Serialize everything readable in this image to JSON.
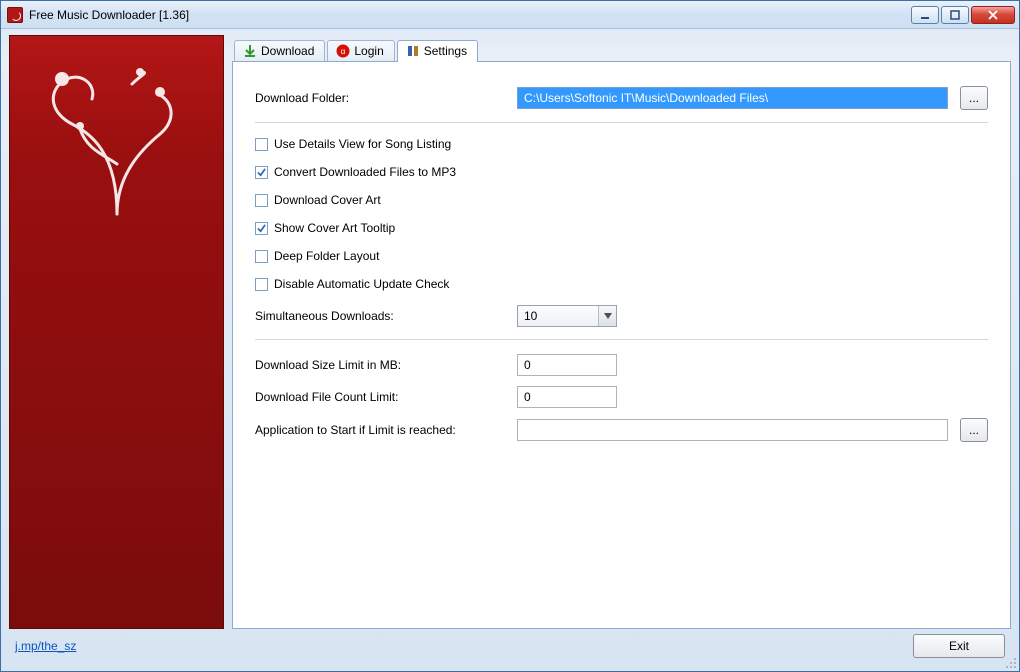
{
  "window": {
    "title": "Free Music Downloader [1.36]"
  },
  "tabs": {
    "download": "Download",
    "login": "Login",
    "settings": "Settings"
  },
  "settings": {
    "download_folder_label": "Download Folder:",
    "download_folder_value": "C:\\Users\\Softonic IT\\Music\\Downloaded Files\\",
    "browse_label": "...",
    "checks": {
      "details_view": {
        "label": "Use Details View for Song Listing",
        "checked": false
      },
      "convert_mp3": {
        "label": "Convert Downloaded Files to MP3",
        "checked": true
      },
      "cover_art": {
        "label": "Download Cover Art",
        "checked": false
      },
      "show_tooltip": {
        "label": "Show Cover Art Tooltip",
        "checked": true
      },
      "deep_layout": {
        "label": "Deep Folder Layout",
        "checked": false
      },
      "disable_upd": {
        "label": "Disable Automatic Update Check",
        "checked": false
      }
    },
    "simul_label": "Simultaneous Downloads:",
    "simul_value": "10",
    "size_limit_label": "Download Size Limit in MB:",
    "size_limit_value": "0",
    "count_limit_label": "Download File Count Limit:",
    "count_limit_value": "0",
    "app_on_limit_label": "Application to Start if Limit is reached:",
    "app_on_limit_value": ""
  },
  "footer": {
    "link_text": "j.mp/the_sz",
    "exit_label": "Exit"
  }
}
